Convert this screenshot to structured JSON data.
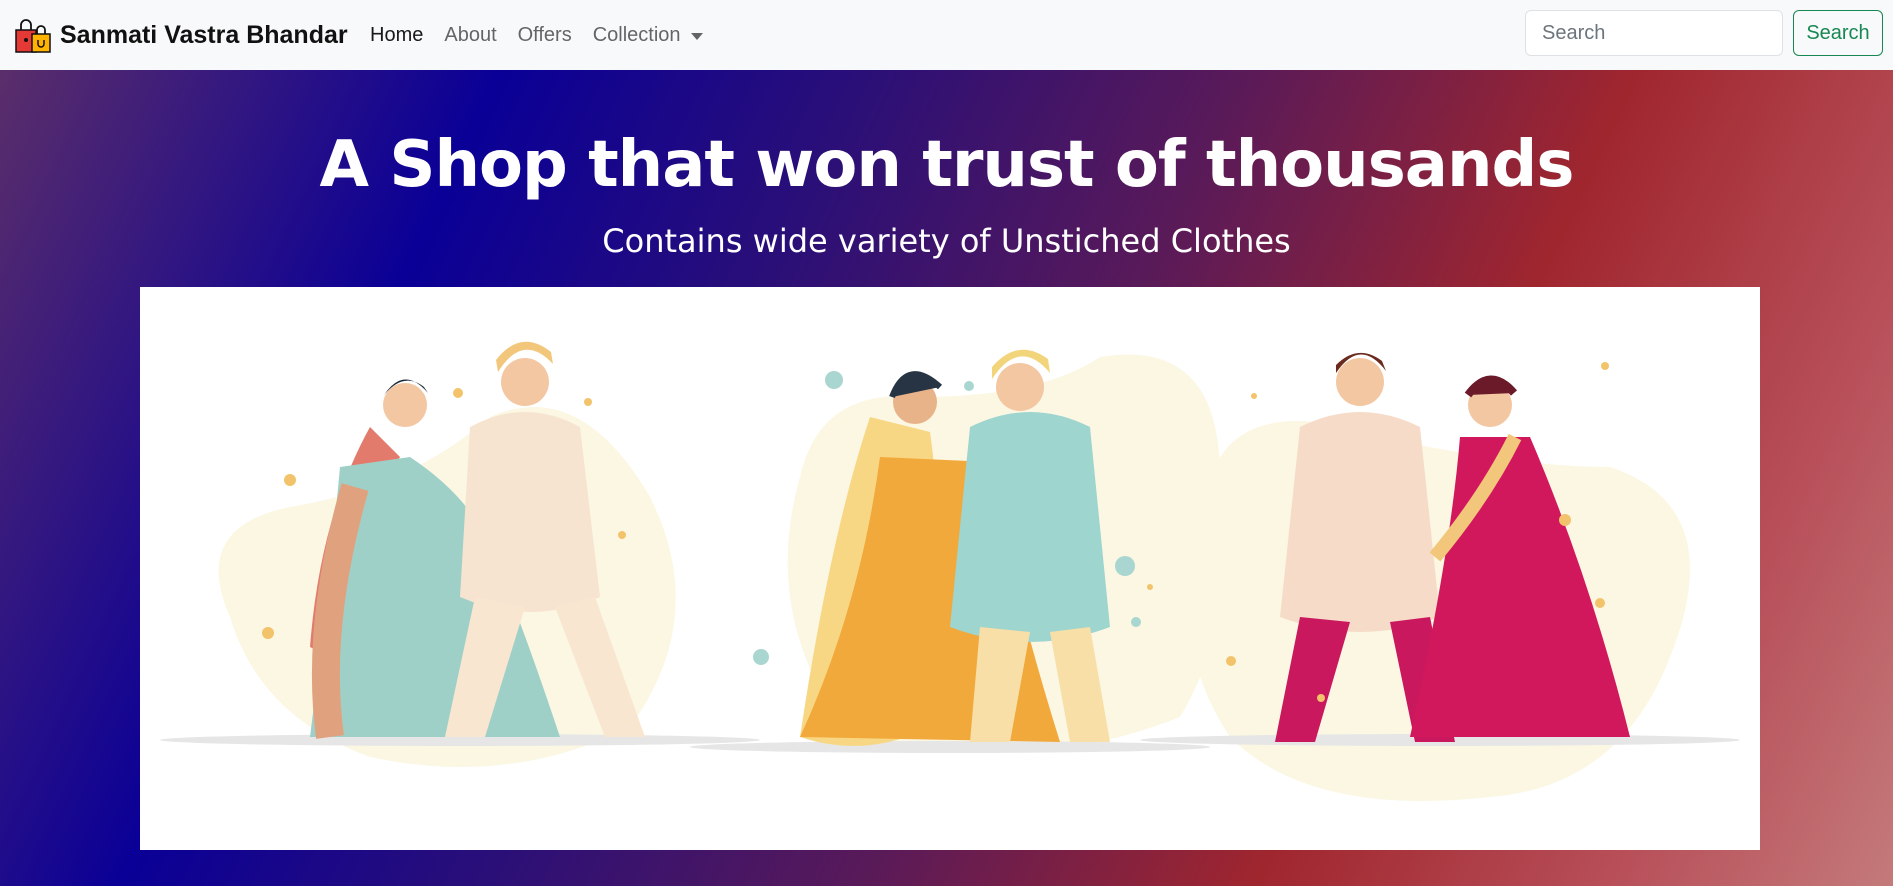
{
  "navbar": {
    "brand": "Sanmati Vastra Bhandar",
    "brand_icon": "shopping-bags-icon",
    "links": [
      {
        "label": "Home",
        "active": true
      },
      {
        "label": "About",
        "active": false
      },
      {
        "label": "Offers",
        "active": false
      },
      {
        "label": "Collection",
        "active": false,
        "dropdown": true
      }
    ],
    "search_placeholder": "Search",
    "search_button": "Search"
  },
  "hero": {
    "title": "A Shop that won trust of thousands",
    "subtitle": "Contains wide variety of Unstiched Clothes",
    "image": "illustration-three-indian-couples-traditional-attire"
  },
  "colors": {
    "navbar_bg": "#f8f9fa",
    "accent_green": "#198754",
    "gradient": [
      "#5b2e6a",
      "#0a0097",
      "#5a1a58",
      "#a0262e",
      "#c47a7a"
    ]
  }
}
